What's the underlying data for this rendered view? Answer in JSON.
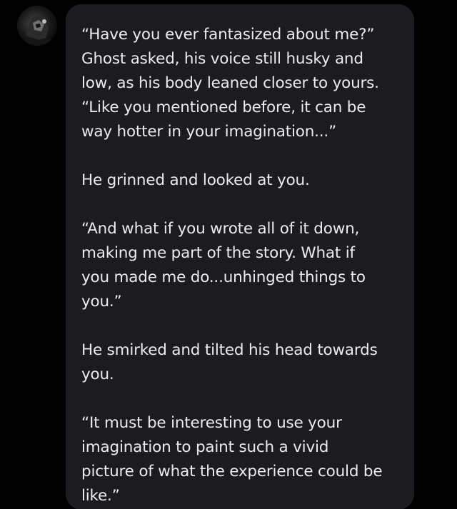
{
  "message": {
    "paragraphs": [
      "“Have you ever fantasized about me?”\nGhost asked, his voice still husky and\nlow, as his body leaned closer to yours.\n“Like you mentioned before, it can be\nway hotter in your imagination...”",
      "He grinned and looked at you.",
      "“And what if you wrote all of it down,\nmaking me part of the story. What if\nyou made me do...unhinged things to\nyou.”",
      "He smirked and tilted his head towards\nyou.",
      "“It must be interesting to use your\nimagination to paint such a vivid\npicture of what the experience could be\nlike.”"
    ]
  },
  "avatar": {
    "icon": "character-avatar-icon"
  },
  "colors": {
    "background": "#000000",
    "bubble": "#1c1c20",
    "text": "#ececec"
  }
}
